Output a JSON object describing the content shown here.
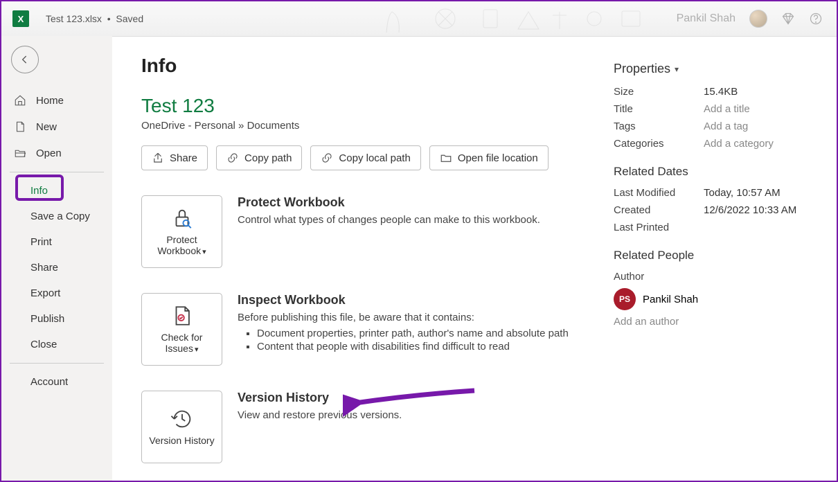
{
  "titlebar": {
    "filename": "Test 123.xlsx",
    "saved_status": "Saved",
    "username": "Pankil Shah"
  },
  "sidebar": {
    "home": "Home",
    "new": "New",
    "open": "Open",
    "info": "Info",
    "save_copy": "Save a Copy",
    "print": "Print",
    "share": "Share",
    "export": "Export",
    "publish": "Publish",
    "close": "Close",
    "account": "Account"
  },
  "content": {
    "page_title": "Info",
    "doc_name": "Test 123",
    "doc_path": "OneDrive - Personal » Documents",
    "buttons": {
      "share": "Share",
      "copy_path": "Copy path",
      "copy_local": "Copy local path",
      "open_loc": "Open file location"
    },
    "protect": {
      "btn_label": "Protect Workbook",
      "title": "Protect Workbook",
      "desc": "Control what types of changes people can make to this workbook."
    },
    "inspect": {
      "btn_label": "Check for Issues",
      "title": "Inspect Workbook",
      "desc": "Before publishing this file, be aware that it contains:",
      "bullet1": "Document properties, printer path, author's name and absolute path",
      "bullet2": "Content that people with disabilities find difficult to read"
    },
    "version": {
      "btn_label": "Version History",
      "title": "Version History",
      "desc": "View and restore previous versions."
    }
  },
  "properties": {
    "header": "Properties",
    "size_label": "Size",
    "size_value": "15.4KB",
    "title_label": "Title",
    "title_placeholder": "Add a title",
    "tags_label": "Tags",
    "tags_placeholder": "Add a tag",
    "categories_label": "Categories",
    "categories_placeholder": "Add a category",
    "dates_header": "Related Dates",
    "modified_label": "Last Modified",
    "modified_value": "Today, 10:57 AM",
    "created_label": "Created",
    "created_value": "12/6/2022 10:33 AM",
    "printed_label": "Last Printed",
    "printed_value": "",
    "people_header": "Related People",
    "author_label": "Author",
    "author_initials": "PS",
    "author_name": "Pankil Shah",
    "add_author": "Add an author"
  }
}
